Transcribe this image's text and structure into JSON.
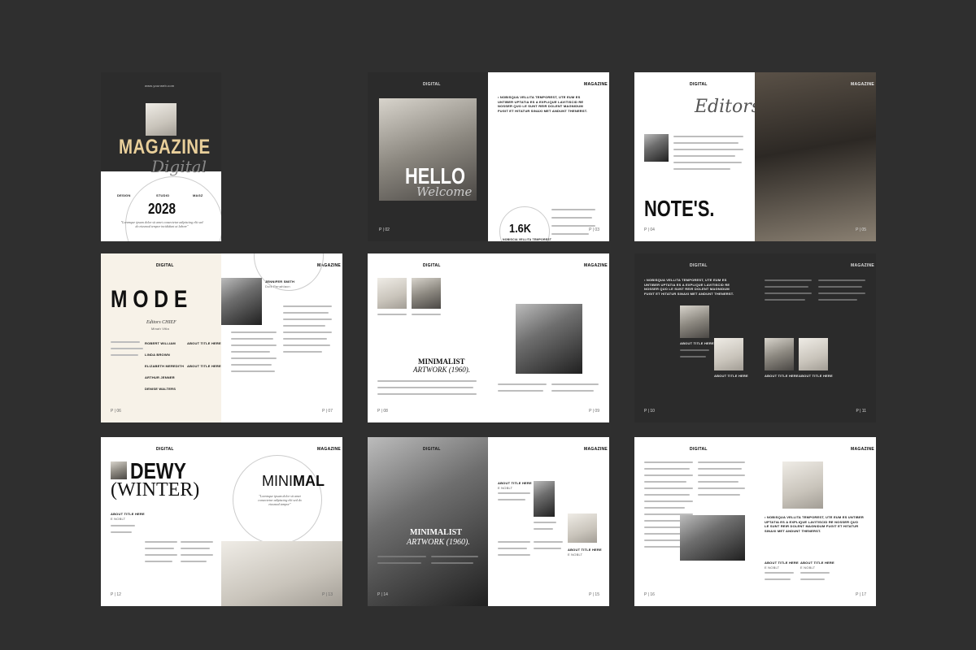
{
  "spreads": {
    "s1": {
      "url": "www.yourweb.com",
      "magazine": "MAGAZINE",
      "digital": "Digital",
      "col1": "DESIGN",
      "col2": "STUDIO",
      "col3": "MAGZ",
      "year": "2028",
      "quote": "\"Loremque ipsum dolor sit amet consectetur adipiscing elit sed do eiusmod tempor incididunt ut labore\""
    },
    "s2": {
      "hdr_left": "DIGITAL",
      "hdr_right": "MAGAZINE",
      "hello": "HELLO",
      "welcome": "Welcome",
      "intro": "• NOBISQUA VELLITA TEMPOREST, UTE EUM ES UNTIBER UPTATIA ES A EXPLIQUE LAVITISCID RE NOSSER QUO LE SUNT REIR DOLENT MAGNIDUM FUGIT ET HITATUR SINAXI MET ANDUNT THENERST.",
      "stat": "1.6K",
      "stat_label": "NOBISCIA VELLITA TEMPOREST",
      "folio_l": "P | 02",
      "folio_r": "P | 03"
    },
    "s3": {
      "hdr_left": "DIGITAL",
      "hdr_right": "MAGAZINE",
      "editors": "Editors",
      "notes": "NOTE'S.",
      "folio_l": "P | 04",
      "folio_r": "P | 05"
    },
    "s4": {
      "hdr_left": "DIGITAL",
      "hdr_right": "MAGAZINE",
      "mode": "M O D E",
      "editors_chief": "Editors CHIEF",
      "chief_name": "Minah Vitla",
      "names": [
        "ROBERT WILLIAM",
        "LINDA BROWN",
        "ELIZABETH MEREDITH",
        "ARTHUR JENNER",
        "DENISE WALTERS"
      ],
      "about1": "ABOUT TITLE HERE",
      "about2": "ABOUT TITLE HERE",
      "byline": "JENNIFER SMITH",
      "byline_sub": "Duis Penahlacn",
      "folio_l": "P | 06",
      "folio_r": "P | 07"
    },
    "s5": {
      "hdr_left": "DIGITAL",
      "hdr_right": "MAGAZINE",
      "minimalist": "MINIMALIST",
      "artwork": "ARTWORK (1960).",
      "folio_l": "P | 08",
      "folio_r": "P | 09"
    },
    "s6": {
      "hdr_left": "DIGITAL",
      "hdr_right": "MAGAZINE",
      "intro": "• NOBISQUA VELLITA TEMPOREST, UTE EUM ES UNTIBER UPTATIA ES A EXPLIQUE LAVITISCID RE NOSSER QUO LE SUNT REIR DOLENT MAGNIDUM FUGIT ET HITATUR SINAXI MET ANDUNT THENERST.",
      "about": "ABOUT TITLE HERE",
      "folio_l": "P | 10",
      "folio_r": "P | 11"
    },
    "s7": {
      "hdr_left": "DIGITAL",
      "hdr_right": "MAGAZINE",
      "dewy": "DEWY",
      "winter": "(WINTER)",
      "mini": "MINI",
      "mal": "MAL",
      "about": "ABOUT TITLE HERE",
      "about_sub": "E NOBLT",
      "quote": "\"Loremque ipsum dolor sit amet consectetur adipiscing elit sed do eiusmod tempor\"",
      "folio_l": "P | 12",
      "folio_r": "P | 13"
    },
    "s8": {
      "hdr_left": "DIGITAL",
      "hdr_right": "MAGAZINE",
      "minimalist": "MINIMALIST",
      "artwork": "ARTWORK (1960).",
      "about": "ABOUT TITLE HERE",
      "about_sub": "E NOBLT",
      "folio_l": "P | 14",
      "folio_r": "P | 15"
    },
    "s9": {
      "hdr_left": "DIGITAL",
      "hdr_right": "MAGAZINE",
      "intro": "• NOBISQUA VELLITA TEMPOREST, UTE EUM ES UNTIBER UPTATIA ES A EXPLIQUE LAVITISCID RE NOSSER QUO LE SUNT REIR DOLENT MAGNIDUM FUGIT ET HITATUR SINAXI MET ANDUNT THENERST.",
      "about": "ABOUT TITLE HERE",
      "about_sub": "E NOBLT",
      "folio_l": "P | 16",
      "folio_r": "P | 17"
    }
  }
}
